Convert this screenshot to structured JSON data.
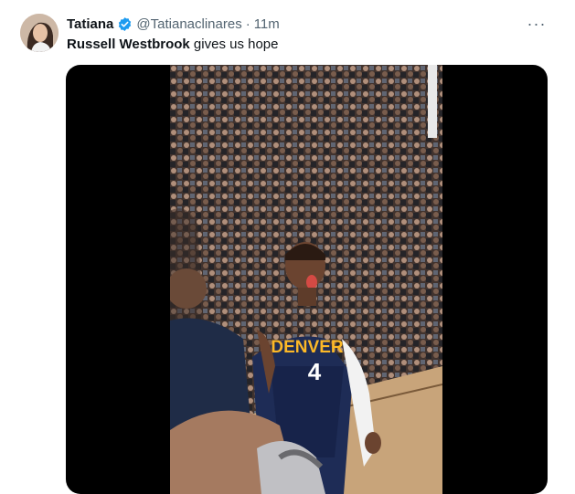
{
  "tweet": {
    "display_name": "Tatiana",
    "handle": "@Tatianaclinares",
    "separator": "·",
    "time": "11m",
    "text_strong": "Russell Westbrook",
    "text_rest": " gives us hope",
    "more_label": "···"
  },
  "icons": {
    "verified": "verified-badge-icon",
    "more": "more-horizontal-icon"
  },
  "colors": {
    "verified_blue": "#1d9bf0",
    "secondary_text": "#536471",
    "primary_text": "#0f1419"
  },
  "video": {
    "jersey_text": "DENVER",
    "jersey_number": "4"
  }
}
